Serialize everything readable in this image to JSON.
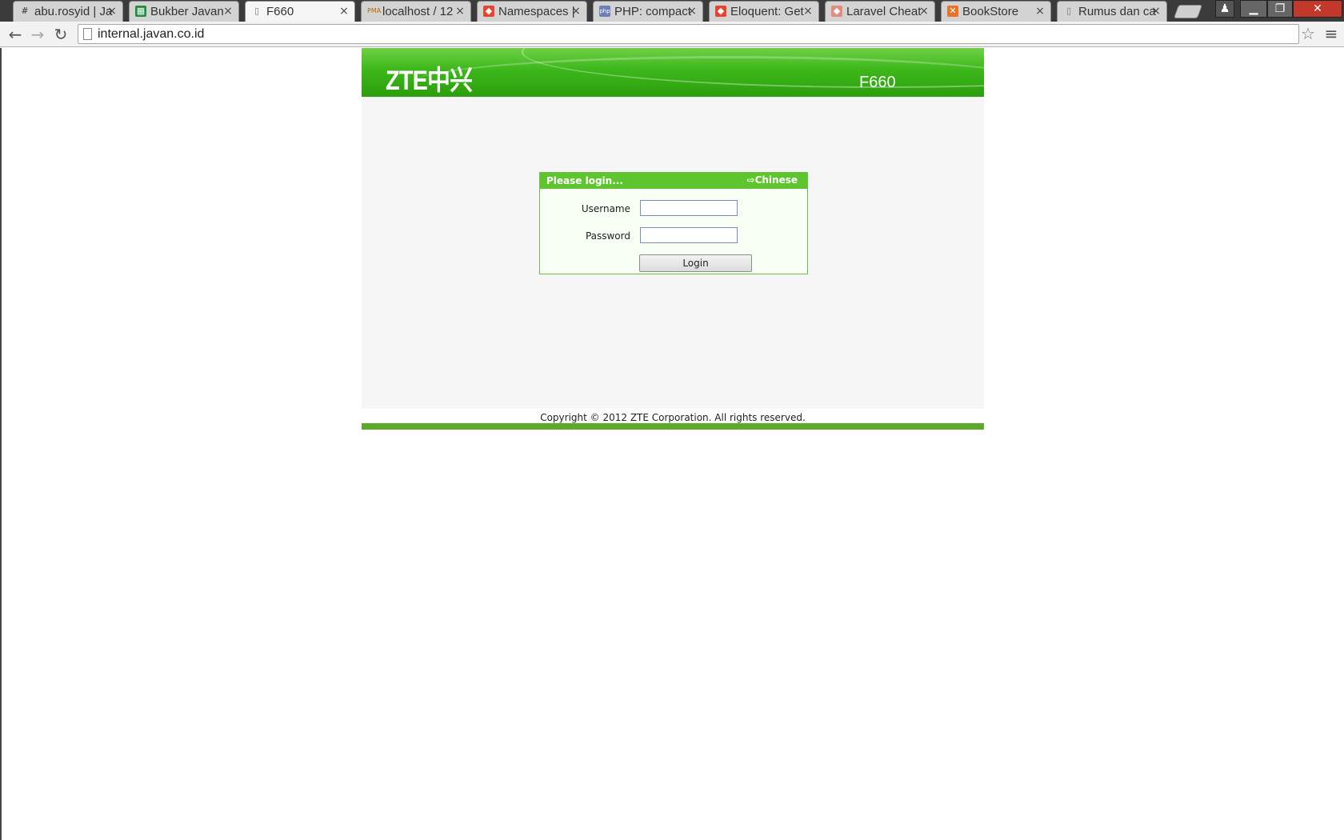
{
  "browser": {
    "tabs": [
      {
        "title": "abu.rosyid | Ja",
        "favicon": "hash-icon",
        "active": false
      },
      {
        "title": "Bukber Javan",
        "favicon": "sheets-icon",
        "active": false
      },
      {
        "title": "F660",
        "favicon": "page-icon",
        "active": true
      },
      {
        "title": "localhost / 12",
        "favicon": "phpmyadmin-icon",
        "active": false
      },
      {
        "title": "Namespaces |",
        "favicon": "laravel-icon",
        "active": false
      },
      {
        "title": "PHP: compact",
        "favicon": "php-icon",
        "active": false
      },
      {
        "title": "Eloquent: Get",
        "favicon": "laravel-icon",
        "active": false
      },
      {
        "title": "Laravel Cheat",
        "favicon": "laravel-icon",
        "active": false
      },
      {
        "title": "BookStore",
        "favicon": "xampp-icon",
        "active": false
      },
      {
        "title": "Rumus dan ca",
        "favicon": "page-icon",
        "active": false
      }
    ],
    "url": "internal.javan.co.id"
  },
  "router": {
    "logo": "ZTE中兴",
    "model": "F660",
    "login": {
      "title": "Please login...",
      "language_link": "Chinese",
      "username_label": "Username",
      "password_label": "Password",
      "username_value": "",
      "password_value": "",
      "button_label": "Login"
    },
    "copyright": "Copyright © 2012 ZTE Corporation. All rights reserved."
  },
  "colors": {
    "brand_green": "#3cb71a",
    "login_header": "#5ec52e",
    "footer_bar": "#5da92a",
    "page_background": "#f6f6f6"
  }
}
